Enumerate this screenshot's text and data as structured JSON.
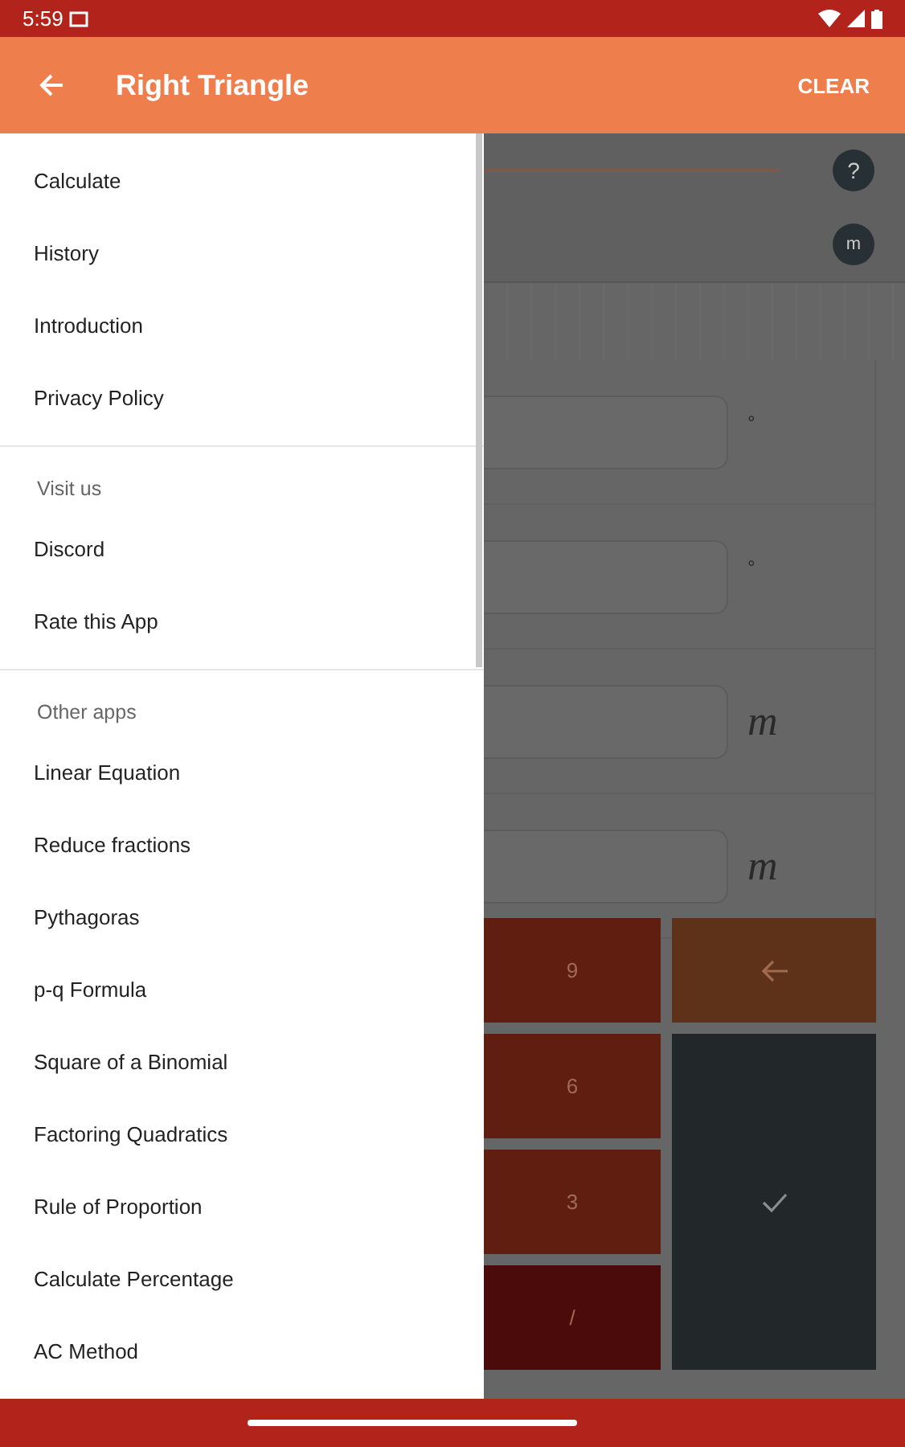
{
  "status_bar": {
    "time": "5:59"
  },
  "app_bar": {
    "title": "Right Triangle",
    "action": "CLEAR"
  },
  "drawer": {
    "sections": [
      {
        "items": [
          "Calculate",
          "History",
          "Introduction",
          "Privacy Policy"
        ]
      },
      {
        "header": "Visit us",
        "items": [
          "Discord",
          "Rate this App"
        ]
      },
      {
        "header": "Other apps",
        "items": [
          "Linear Equation",
          "Reduce fractions",
          "Pythagoras",
          "p-q Formula",
          "Square of a Binomial",
          "Factoring Quadratics",
          "Rule of Proportion",
          "Calculate Percentage",
          "AC Method"
        ]
      }
    ]
  },
  "content": {
    "help_button": "?",
    "unit_button": "m",
    "fields": [
      {
        "unit": "°",
        "kind": "degree"
      },
      {
        "unit": "°",
        "kind": "degree"
      },
      {
        "unit": "m",
        "kind": "length"
      },
      {
        "unit": "m",
        "kind": "length"
      }
    ],
    "keys": [
      {
        "label": "9",
        "kind": "digit"
      },
      {
        "kind": "backspace"
      },
      {
        "label": "6",
        "kind": "digit"
      },
      {
        "kind": "enter"
      },
      {
        "label": "3",
        "kind": "digit"
      },
      {
        "label": "/",
        "kind": "operator"
      }
    ]
  }
}
